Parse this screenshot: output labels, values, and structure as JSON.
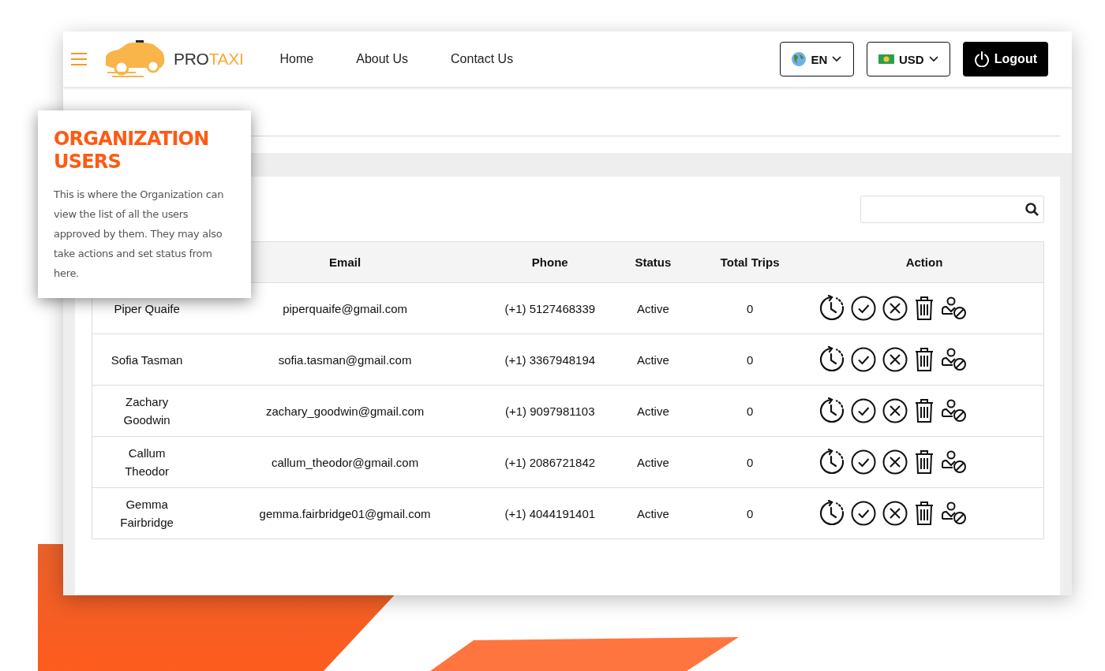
{
  "header": {
    "logo": {
      "prefix": "PRO",
      "suffix": "TAXI"
    },
    "nav": [
      "Home",
      "About Us",
      "Contact Us"
    ],
    "language": "EN",
    "currency": "USD",
    "logout": "Logout"
  },
  "tooltip": {
    "title": "ORGANIZATION USERS",
    "text": "This is where the Organization can view the list of all the users approved by them. They may also take actions and set status from here."
  },
  "table": {
    "columns": [
      "Email",
      "Phone",
      "Status",
      "Total Trips",
      "Action"
    ],
    "rows": [
      {
        "name": "Piper Quaife",
        "email": "piperquaife@gmail.com",
        "phone": "(+1) 5127468339",
        "status": "Active",
        "total_trips": "0"
      },
      {
        "name": "Sofia Tasman",
        "email": "sofia.tasman@gmail.com",
        "phone": "(+1) 3367948194",
        "status": "Active",
        "total_trips": "0"
      },
      {
        "name": "Zachary Goodwin",
        "email": "zachary_goodwin@gmail.com",
        "phone": "(+1) 9097981103",
        "status": "Active",
        "total_trips": "0"
      },
      {
        "name": "Callum Theodor",
        "email": "callum_theodor@gmail.com",
        "phone": "(+1) 2086721842",
        "status": "Active",
        "total_trips": "0"
      },
      {
        "name": "Gemma Fairbridge",
        "email": "gemma.fairbridge01@gmail.com",
        "phone": "(+1) 4044191401",
        "status": "Active",
        "total_trips": "0"
      }
    ]
  }
}
